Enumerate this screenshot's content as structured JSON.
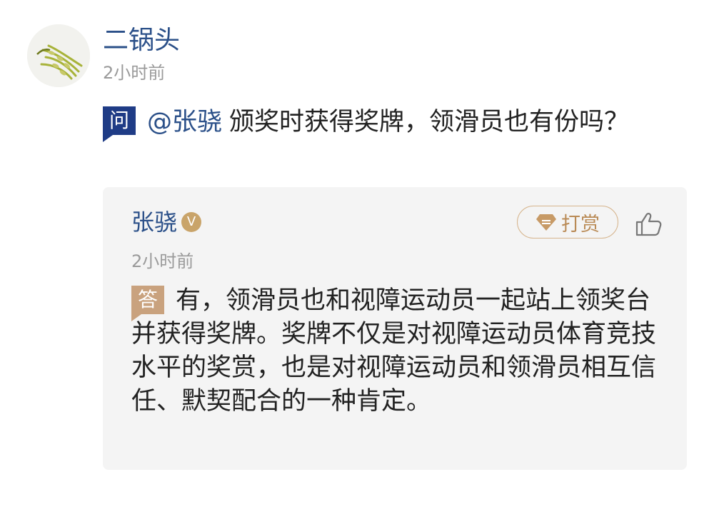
{
  "question": {
    "author_name": "二锅头",
    "time": "2小时前",
    "badge": "问",
    "mention": "@张骁",
    "text": "颁奖时获得奖牌，领滑员也有份吗？"
  },
  "answer": {
    "author_name": "张骁",
    "verified_badge": "V",
    "tip_label": "打赏",
    "time": "2小时前",
    "badge": "答",
    "text": "有，领滑员也和视障运动员一起站上领奖台并获得奖牌。奖牌不仅是对视障运动员体育竞技水平的奖赏，也是对视障运动员和领滑员相互信任、默契配合的一种肯定。"
  },
  "icons": {
    "avatar": "grass-avatar-icon",
    "verified": "verified-v-icon",
    "tip": "gem-icon",
    "like": "thumbs-up-icon"
  },
  "colors": {
    "link_blue": "#2b5089",
    "question_badge": "#1f3c86",
    "answer_badge": "#c9a27e",
    "tip_gold": "#b98a55",
    "card_background": "#f4f4f4",
    "muted_text": "#9a9a9a"
  }
}
